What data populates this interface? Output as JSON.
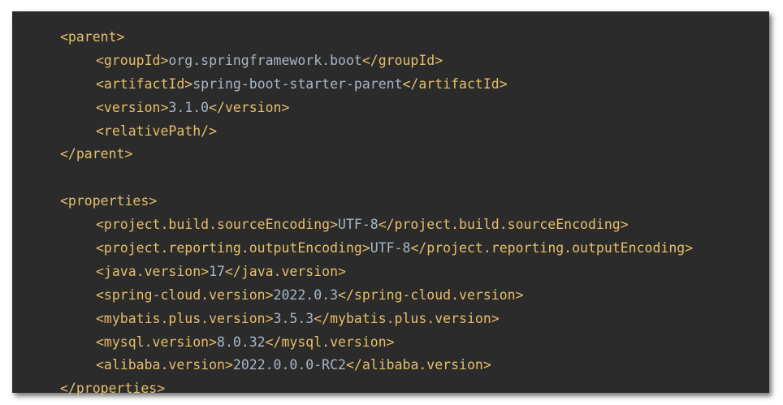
{
  "colors": {
    "background": "#2b2b2b",
    "tag": "#e8bf6a",
    "text": "#a9b7c6"
  },
  "lines": [
    {
      "indent": 0,
      "tag_open": "<parent>",
      "text": "",
      "tag_close": ""
    },
    {
      "indent": 1,
      "tag_open": "<groupId>",
      "text": "org.springframework.boot",
      "tag_close": "</groupId>"
    },
    {
      "indent": 1,
      "tag_open": "<artifactId>",
      "text": "spring-boot-starter-parent",
      "tag_close": "</artifactId>"
    },
    {
      "indent": 1,
      "tag_open": "<version>",
      "text": "3.1.0",
      "tag_close": "</version>"
    },
    {
      "indent": 1,
      "tag_open": "<relativePath/>",
      "text": "",
      "tag_close": ""
    },
    {
      "indent": 0,
      "tag_open": "</parent>",
      "text": "",
      "tag_close": ""
    },
    {
      "indent": 0,
      "tag_open": "",
      "text": "",
      "tag_close": ""
    },
    {
      "indent": 0,
      "tag_open": "<properties>",
      "text": "",
      "tag_close": ""
    },
    {
      "indent": 1,
      "tag_open": "<project.build.sourceEncoding>",
      "text": "UTF-8",
      "tag_close": "</project.build.sourceEncoding>"
    },
    {
      "indent": 1,
      "tag_open": "<project.reporting.outputEncoding>",
      "text": "UTF-8",
      "tag_close": "</project.reporting.outputEncoding>"
    },
    {
      "indent": 1,
      "tag_open": "<java.version>",
      "text": "17",
      "tag_close": "</java.version>"
    },
    {
      "indent": 1,
      "tag_open": "<spring-cloud.version>",
      "text": "2022.0.3",
      "tag_close": "</spring-cloud.version>"
    },
    {
      "indent": 1,
      "tag_open": "<mybatis.plus.version>",
      "text": "3.5.3",
      "tag_close": "</mybatis.plus.version>"
    },
    {
      "indent": 1,
      "tag_open": "<mysql.version>",
      "text": "8.0.32",
      "tag_close": "</mysql.version>"
    },
    {
      "indent": 1,
      "tag_open": "<alibaba.version>",
      "text": "2022.0.0.0-RC2",
      "tag_close": "</alibaba.version>"
    },
    {
      "indent": 0,
      "tag_open": "</properties>",
      "text": "",
      "tag_close": ""
    }
  ]
}
